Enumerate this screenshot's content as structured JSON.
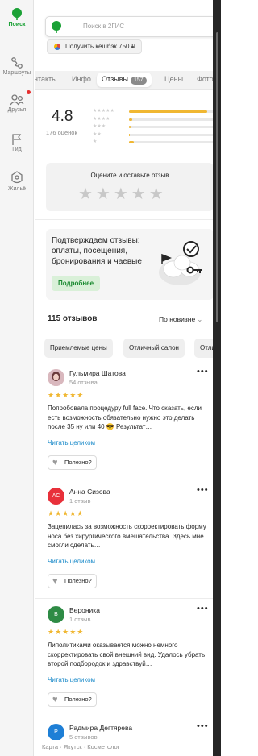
{
  "nav": {
    "items": [
      {
        "label": "Поиск",
        "icon": "search-leaf-icon",
        "active": true
      },
      {
        "label": "Маршруты",
        "icon": "routes-icon"
      },
      {
        "label": "Друзья",
        "icon": "friends-icon"
      },
      {
        "label": "Гид",
        "icon": "flag-icon"
      },
      {
        "label": "Жильё",
        "icon": "housing-icon"
      }
    ]
  },
  "search": {
    "placeholder": "Поиск в 2ГИС"
  },
  "cashback": {
    "label": "Получить кешбэк 750 ₽"
  },
  "tabs": [
    {
      "label": "нтакты"
    },
    {
      "label": "Инфо"
    },
    {
      "label": "Отзывы",
      "count": "157",
      "active": true
    },
    {
      "label": "Цены"
    },
    {
      "label": "Фото"
    }
  ],
  "rating": {
    "value": "4.8",
    "count_text": "176 оценок",
    "distribution": [
      {
        "stars": "★★★★★",
        "share": 0.92
      },
      {
        "stars": "★★★★",
        "share": 0.04
      },
      {
        "stars": "★★★",
        "share": 0.02
      },
      {
        "stars": "★★",
        "share": 0.01
      },
      {
        "stars": "★",
        "share": 0.06
      }
    ]
  },
  "rate_prompt": {
    "title": "Оцените и оставьте отзыв",
    "stars": "★★★★★"
  },
  "promo": {
    "text": "Подтверждаем отзывы: оплаты, посещения, бронирования и чаевые",
    "button": "Подробнее"
  },
  "reviews_header": {
    "count": "115 отзывов",
    "sort": "По новизне",
    "sort_icon": "chevron-down-icon"
  },
  "chips": [
    "Приемлемые цены",
    "Отличный салон",
    "Отли"
  ],
  "reviews": [
    {
      "name": "Гульмира Шатова",
      "sub": "54 отзыва",
      "initials": "",
      "avatar_color": "#b06a7a",
      "stars": "★★★★★",
      "text": "Попробовала процедуру full face. Что сказать, если есть возможность обязательно нужно это делать после 35 ну или 40 😎 Результат…",
      "read_more": "Читать целиком",
      "useful": "Полезно?"
    },
    {
      "name": "Анна Сизова",
      "sub": "1 отзыв",
      "initials": "АС",
      "avatar_color": "#e8303a",
      "stars": "★★★★★",
      "text": "Зацепилась за возможность скорректировать форму носа без хирургического вмешательства. Здесь мне смогли сделать…",
      "read_more": "Читать целиком",
      "useful": "Полезно?"
    },
    {
      "name": "Вероника",
      "sub": "1 отзыв",
      "initials": "В",
      "avatar_color": "#2e8b45",
      "stars": "★★★★★",
      "text": "Липолитиками оказывается можно немного скорректировать свой внешний вид. Удалось убрать второй подбородок и здравствуй…",
      "read_more": "Читать целиком",
      "useful": "Полезно?"
    },
    {
      "name": "Радмира Дегтярева",
      "sub": "5 отзывов",
      "initials": "Р",
      "avatar_color": "#1e7fd6"
    }
  ],
  "footer": "Карта · Якутск · Косметолог"
}
